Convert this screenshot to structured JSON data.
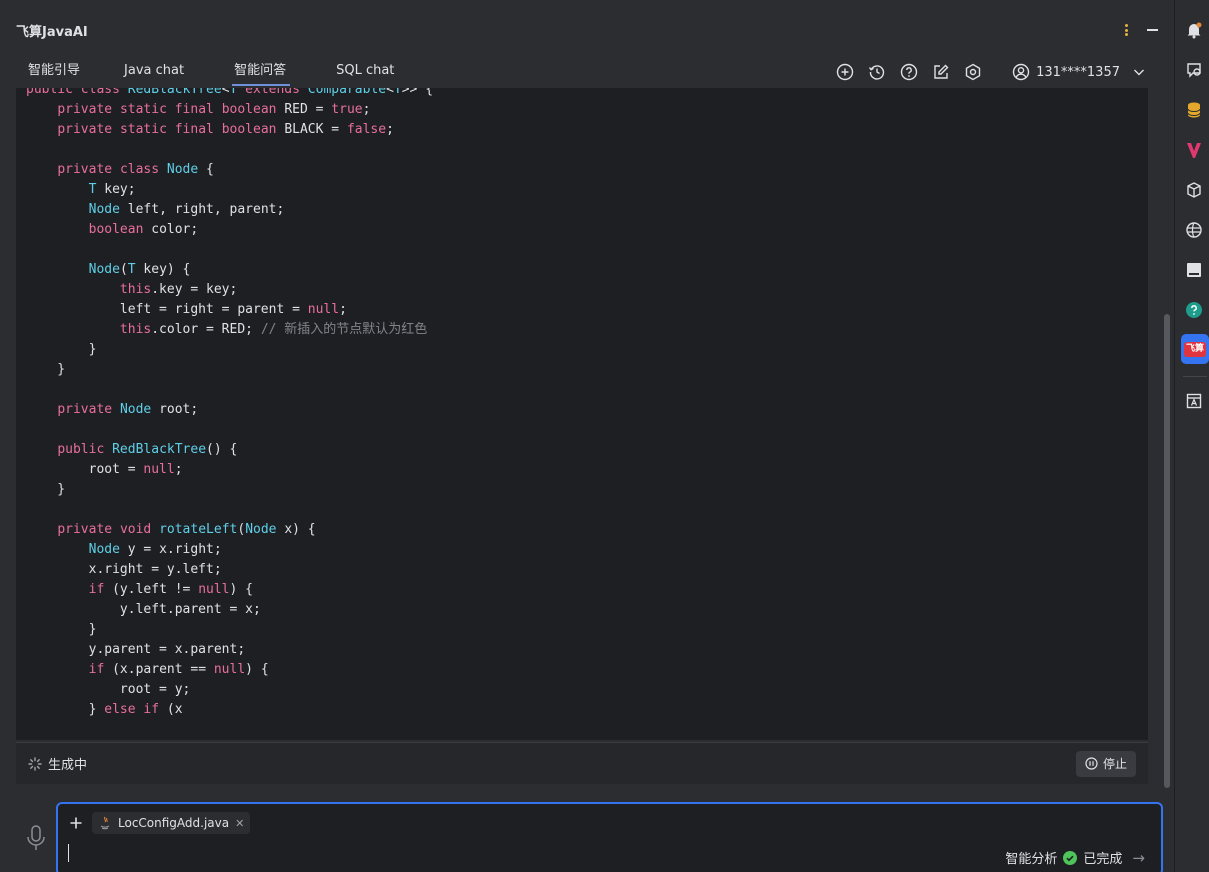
{
  "app": {
    "title": "飞算JavaAI"
  },
  "tabs": [
    {
      "label": "智能引导"
    },
    {
      "label": "Java chat"
    },
    {
      "label": "智能问答"
    },
    {
      "label": "SQL chat"
    }
  ],
  "active_tab": "智能问答",
  "toolbar_icons": [
    "add-icon",
    "history-icon",
    "help-icon",
    "edit-icon",
    "settings-icon"
  ],
  "user": {
    "name": "131****1357"
  },
  "code": {
    "lines": [
      "public class RedBlackTree<T extends Comparable<T>> {",
      "    private static final boolean RED = true;",
      "    private static final boolean BLACK = false;",
      "",
      "    private class Node {",
      "        T key;",
      "        Node left, right, parent;",
      "        boolean color;",
      "",
      "        Node(T key) {",
      "            this.key = key;",
      "            left = right = parent = null;",
      "            this.color = RED; // 新插入的节点默认为红色",
      "        }",
      "    }",
      "",
      "    private Node root;",
      "",
      "    public RedBlackTree() {",
      "        root = null;",
      "    }",
      "",
      "    private void rotateLeft(Node x) {",
      "        Node y = x.right;",
      "        x.right = y.left;",
      "        if (y.left != null) {",
      "            y.left.parent = x;",
      "        }",
      "        y.parent = x.parent;",
      "        if (x.parent == null) {",
      "            root = y;",
      "        } else if (x"
    ]
  },
  "generation": {
    "status": "生成中",
    "stop_label": "停止"
  },
  "input": {
    "attachment": "LocConfigAdd.java",
    "status_label": "智能分析",
    "done_label": "已完成"
  },
  "sidebar_icons": [
    "notification-icon",
    "ai-chat-icon",
    "database-icon",
    "vue-icon",
    "package-icon",
    "plugin-icon",
    "terminal-icon",
    "help-icon",
    "feisuan-icon",
    "document-icon"
  ],
  "sidebar_active_label": "飞算",
  "colors": {
    "accent": "#3574f0",
    "keyword": "#e76f9a",
    "type": "#5fcfe8",
    "success": "#4ec45a",
    "brand": "#e0343f"
  }
}
